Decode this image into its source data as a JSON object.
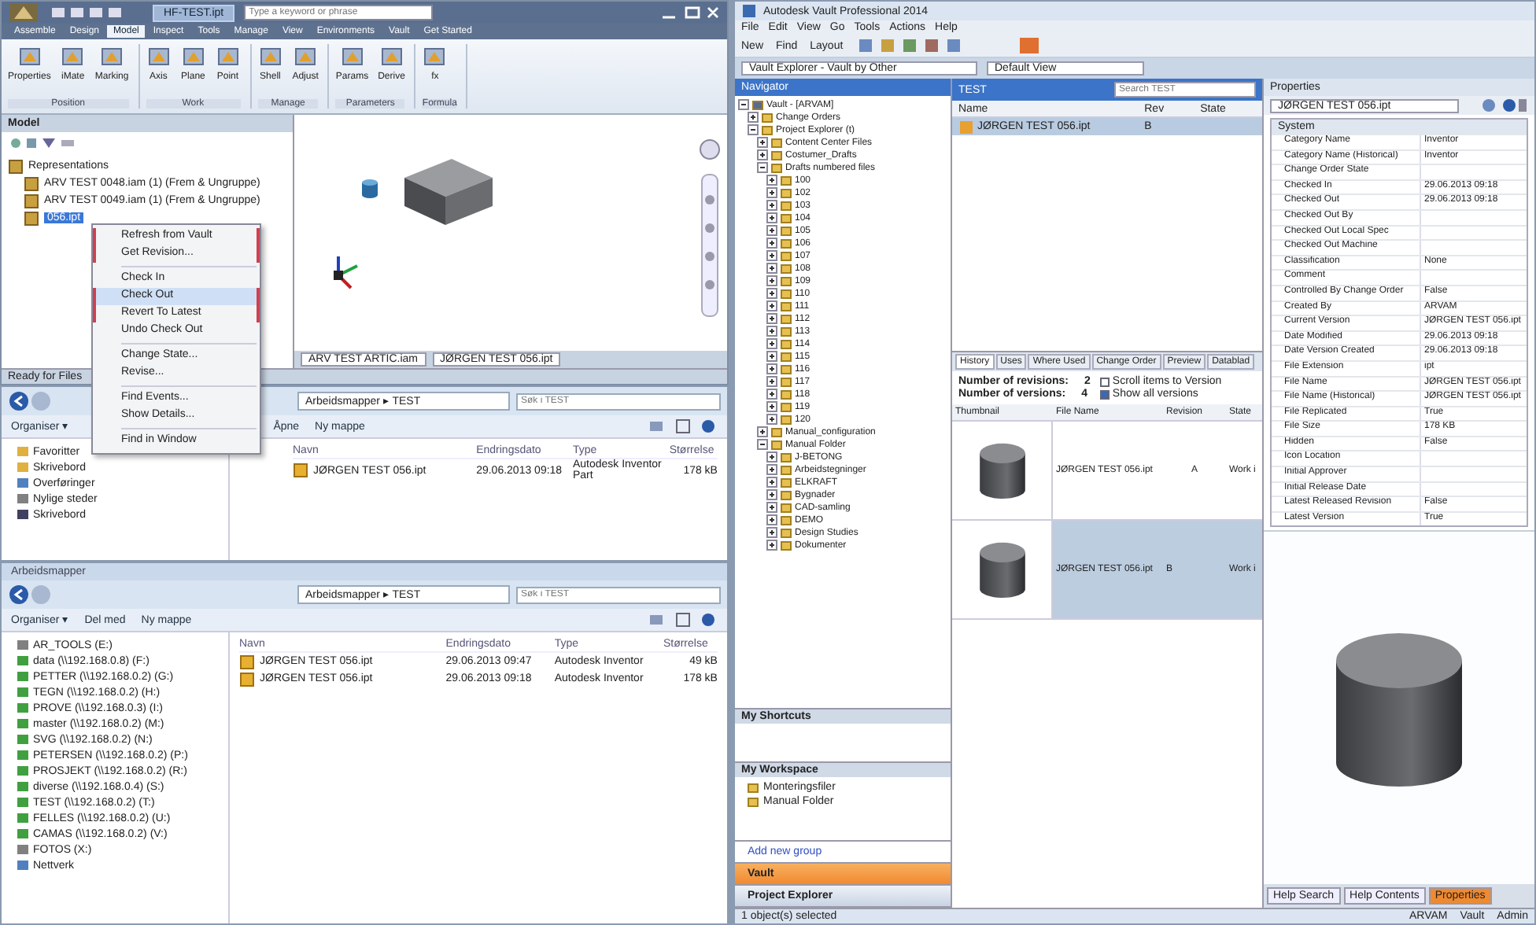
{
  "inventor": {
    "title_tab": "HF-TEST.ipt",
    "search": {
      "placeholder": "Type a keyword or phrase"
    },
    "ribbon_tabs": [
      {
        "label": "Assemble",
        "selected": false
      },
      {
        "label": "Design",
        "selected": false
      },
      {
        "label": "Model",
        "selected": true
      },
      {
        "label": "Inspect",
        "selected": false
      },
      {
        "label": "Tools",
        "selected": false
      },
      {
        "label": "Manage",
        "selected": false
      },
      {
        "label": "View",
        "selected": false
      },
      {
        "label": "Environments",
        "selected": false
      },
      {
        "label": "Vault",
        "selected": false
      },
      {
        "label": "Get Started",
        "selected": false
      }
    ],
    "ribbon_panels": [
      {
        "title": "Position",
        "tools": [
          "Properties",
          "iMate",
          "Marking"
        ]
      },
      {
        "title": "Work",
        "tools": [
          "Axis",
          "Plane",
          "Point"
        ]
      },
      {
        "title": "Manage",
        "tools": [
          "Shell",
          "Adjust"
        ]
      },
      {
        "title": "Parameters",
        "tools": [
          "Params",
          "Derive"
        ]
      },
      {
        "title": "Formula",
        "tools": [
          "fx"
        ]
      }
    ],
    "browser": {
      "title": "Model",
      "items": [
        {
          "label": "Representations",
          "selected": false
        },
        {
          "label": "ARV TEST 0048.iam (1) (Frem & Ungruppe)",
          "selected": false
        },
        {
          "label": "ARV TEST 0049.iam (1) (Frem & Ungruppe)",
          "selected": false
        },
        {
          "label": "056.ipt",
          "selected": true
        }
      ]
    },
    "viewport_tabs": [
      "ARV TEST ARTIC.iam",
      "JØRGEN TEST 056.ipt"
    ],
    "status": "Ready for Files"
  },
  "context_menu": [
    {
      "kind": "item",
      "label": "Refresh from Vault",
      "boxed": true,
      "hover": false
    },
    {
      "kind": "item",
      "label": "Get Revision...",
      "boxed": true,
      "hover": false
    },
    {
      "kind": "separator"
    },
    {
      "kind": "item",
      "label": "Check In",
      "boxed": false,
      "hover": false
    },
    {
      "kind": "item",
      "label": "Check Out",
      "boxed": true,
      "hover": true
    },
    {
      "kind": "item",
      "label": "Revert To Latest",
      "boxed": true,
      "hover": false
    },
    {
      "kind": "item",
      "label": "Undo Check Out",
      "boxed": false,
      "hover": false
    },
    {
      "kind": "separator"
    },
    {
      "kind": "item",
      "label": "Change State...",
      "boxed": false,
      "hover": false
    },
    {
      "kind": "item",
      "label": "Revise...",
      "boxed": false,
      "hover": false
    },
    {
      "kind": "separator"
    },
    {
      "kind": "item",
      "label": "Find Events...",
      "boxed": false,
      "hover": false
    },
    {
      "kind": "item",
      "label": "Show Details...",
      "boxed": false,
      "hover": false
    },
    {
      "kind": "separator"
    },
    {
      "kind": "item",
      "label": "Find in Window",
      "boxed": false,
      "hover": false
    }
  ],
  "explorers": [
    {
      "address": "Arbeidsmapper ▸ TEST",
      "search": {
        "placeholder": "Søk i TEST"
      },
      "toolbar": [
        "Organiser ▾",
        "Åpne",
        "Ny mappe"
      ],
      "nav": [
        {
          "label": "Favoritter",
          "color": "#e0b040"
        },
        {
          "label": "Skrivebord",
          "color": "#e0b040"
        },
        {
          "label": "Overføringer",
          "color": "#5080c0"
        },
        {
          "label": "Nylige steder",
          "color": "#808080"
        },
        {
          "label": "Skrivebord",
          "color": "#404060"
        }
      ],
      "columns": [
        "Navn",
        "Endringsdato",
        "Type",
        "Størrelse"
      ],
      "files": [
        {
          "name": "JØRGEN TEST 056.ipt",
          "date": "29.06.2013 09:18",
          "type": "Autodesk Inventor Part",
          "size": "178 kB"
        }
      ]
    },
    {
      "title": "Arbeidsmapper",
      "address": "Arbeidsmapper ▸ TEST",
      "search": {
        "placeholder": "Søk i TEST"
      },
      "toolbar": [
        "Organiser ▾",
        "Del med",
        "Ny mappe"
      ],
      "nav": [
        {
          "label": "AR_TOOLS (E:)",
          "color": "#808080"
        },
        {
          "label": "data (\\\\192.168.0.8) (F:)",
          "color": "#40a040"
        },
        {
          "label": "PETTER (\\\\192.168.0.2) (G:)",
          "color": "#40a040"
        },
        {
          "label": "TEGN (\\\\192.168.0.2) (H:)",
          "color": "#40a040"
        },
        {
          "label": "PROVE (\\\\192.168.0.3) (I:)",
          "color": "#40a040"
        },
        {
          "label": "master (\\\\192.168.0.2) (M:)",
          "color": "#40a040"
        },
        {
          "label": "SVG (\\\\192.168.0.2) (N:)",
          "color": "#40a040"
        },
        {
          "label": "PETERSEN (\\\\192.168.0.2) (P:)",
          "color": "#40a040"
        },
        {
          "label": "PROSJEKT (\\\\192.168.0.2) (R:)",
          "color": "#40a040"
        },
        {
          "label": "diverse (\\\\192.168.0.4) (S:)",
          "color": "#40a040"
        },
        {
          "label": "TEST (\\\\192.168.0.2) (T:)",
          "color": "#40a040"
        },
        {
          "label": "FELLES (\\\\192.168.0.2) (U:)",
          "color": "#40a040"
        },
        {
          "label": "CAMAS (\\\\192.168.0.2) (V:)",
          "color": "#40a040"
        },
        {
          "label": "FOTOS (X:)",
          "color": "#808080"
        },
        {
          "label": "Nettverk",
          "color": "#5080c0"
        }
      ],
      "columns": [
        "Navn",
        "Endringsdato",
        "Type",
        "Størrelse"
      ],
      "files": [
        {
          "name": "JØRGEN TEST 056.ipt",
          "date": "29.06.2013 09:47",
          "type": "Autodesk Inventor",
          "size": "49 kB"
        },
        {
          "name": "JØRGEN TEST 056.ipt",
          "date": "29.06.2013 09:18",
          "type": "Autodesk Inventor",
          "size": "178 kB"
        }
      ]
    }
  ],
  "vault": {
    "title": "Autodesk Vault Professional 2014",
    "menu": [
      "File",
      "Edit",
      "View",
      "Go",
      "Tools",
      "Actions",
      "Help"
    ],
    "toolbar": [
      "New",
      "Find",
      "Layout"
    ],
    "location": "Vault Explorer - Vault by Other",
    "view": "Default View",
    "navigator": {
      "title": "Navigator",
      "tree": [
        {
          "label": "Vault - [ARVAM]",
          "expanded": true,
          "children": [
            {
              "label": "Change Orders",
              "expanded": false
            },
            {
              "label": "Project Explorer (t)",
              "expanded": true,
              "children": [
                {
                  "label": "Content Center Files",
                  "expanded": false
                },
                {
                  "label": "Costumer_Drafts",
                  "expanded": false
                },
                {
                  "label": "Drafts numbered files",
                  "expanded": true,
                  "children": [
                    {
                      "label": "100",
                      "expanded": false
                    },
                    {
                      "label": "102",
                      "expanded": false
                    },
                    {
                      "label": "103",
                      "expanded": false
                    },
                    {
                      "label": "104",
                      "expanded": false
                    },
                    {
                      "label": "105",
                      "expanded": false
                    },
                    {
                      "label": "106",
                      "expanded": false
                    },
                    {
                      "label": "107",
                      "expanded": false
                    },
                    {
                      "label": "108",
                      "expanded": false
                    },
                    {
                      "label": "109",
                      "expanded": false
                    },
                    {
                      "label": "110",
                      "expanded": false
                    },
                    {
                      "label": "111",
                      "expanded": false
                    },
                    {
                      "label": "112",
                      "expanded": false
                    },
                    {
                      "label": "113",
                      "expanded": false
                    },
                    {
                      "label": "114",
                      "expanded": false
                    },
                    {
                      "label": "115",
                      "expanded": false
                    },
                    {
                      "label": "116",
                      "expanded": false
                    },
                    {
                      "label": "117",
                      "expanded": false
                    },
                    {
                      "label": "118",
                      "expanded": false
                    },
                    {
                      "label": "119",
                      "expanded": false
                    },
                    {
                      "label": "120",
                      "expanded": false
                    }
                  ]
                },
                {
                  "label": "Manual_configuration",
                  "expanded": false
                },
                {
                  "label": "Manual Folder",
                  "expanded": true,
                  "children": [
                    {
                      "label": "J-BETONG",
                      "expanded": false
                    },
                    {
                      "label": "Arbeidstegninger",
                      "expanded": false
                    },
                    {
                      "label": "ELKRAFT",
                      "expanded": false
                    },
                    {
                      "label": "Bygnader",
                      "expanded": false
                    },
                    {
                      "label": "CAD-samling",
                      "expanded": false
                    },
                    {
                      "label": "DEMO",
                      "expanded": false
                    },
                    {
                      "label": "Design Studies",
                      "expanded": false
                    },
                    {
                      "label": "Dokumenter",
                      "expanded": false
                    }
                  ]
                }
              ]
            }
          ]
        }
      ]
    },
    "shortcuts": {
      "title": "My Shortcuts"
    },
    "groups": {
      "title": "My Workspace",
      "items": [
        "Monteringsfiler",
        "Manual Folder"
      ],
      "link": "Add new group"
    },
    "nav_buttons": [
      {
        "label": "Vault",
        "selected": true
      },
      {
        "label": "Project Explorer",
        "selected": false
      }
    ],
    "folder": {
      "title": "TEST",
      "search": {
        "placeholder": "Search TEST"
      },
      "columns": [
        "Name",
        "Rev",
        "State"
      ],
      "rows": [
        {
          "name": "JØRGEN TEST 056.ipt",
          "rev": "B",
          "selected": true
        }
      ]
    },
    "detail_tabs": [
      {
        "label": "History",
        "selected": true
      },
      {
        "label": "Uses",
        "selected": false
      },
      {
        "label": "Where Used",
        "selected": false
      },
      {
        "label": "Change Order",
        "selected": false
      },
      {
        "label": "Preview",
        "selected": false
      },
      {
        "label": "Datablad",
        "selected": false
      }
    ],
    "history": {
      "stats": [
        {
          "label": "Number of revisions:",
          "value": "2"
        },
        {
          "label": "Number of versions:",
          "value": "4"
        }
      ],
      "options": [
        {
          "label": "Scroll items to Version",
          "checked": false
        },
        {
          "label": "Show all versions",
          "checked": true
        }
      ],
      "columns": [
        "Thumbnail",
        "File Name",
        "Revision",
        "State"
      ],
      "rows": [
        {
          "file": "JØRGEN TEST 056.ipt",
          "revision": "A",
          "state": "Work i",
          "selected": false
        },
        {
          "file": "JØRGEN TEST 056.ipt",
          "revision": "B",
          "state": "Work i",
          "selected": true
        }
      ]
    },
    "properties": {
      "title": "Properties",
      "file": "JØRGEN TEST 056.ipt",
      "group": "System",
      "rows": [
        {
          "name": "Category Name",
          "value": "Inventor"
        },
        {
          "name": "Category Name (Historical)",
          "value": "Inventor"
        },
        {
          "name": "Change Order State",
          "value": ""
        },
        {
          "name": "Checked In",
          "value": "29.06.2013 09:18"
        },
        {
          "name": "Checked Out",
          "value": "29.06.2013 09:18"
        },
        {
          "name": "Checked Out By",
          "value": ""
        },
        {
          "name": "Checked Out Local Spec",
          "value": ""
        },
        {
          "name": "Checked Out Machine",
          "value": ""
        },
        {
          "name": "Classification",
          "value": "None"
        },
        {
          "name": "Comment",
          "value": ""
        },
        {
          "name": "Controlled By Change Order",
          "value": "False"
        },
        {
          "name": "Created By",
          "value": "ARVAM"
        },
        {
          "name": "Current Version",
          "value": "JØRGEN TEST 056.ipt"
        },
        {
          "name": "Date Modified",
          "value": "29.06.2013 09:18"
        },
        {
          "name": "Date Version Created",
          "value": "29.06.2013 09:18"
        },
        {
          "name": "File Extension",
          "value": "ipt"
        },
        {
          "name": "File Name",
          "value": "JØRGEN TEST 056.ipt"
        },
        {
          "name": "File Name (Historical)",
          "value": "JØRGEN TEST 056.ipt"
        },
        {
          "name": "File Replicated",
          "value": "True"
        },
        {
          "name": "File Size",
          "value": "178 KB"
        },
        {
          "name": "Hidden",
          "value": "False"
        },
        {
          "name": "Icon Location",
          "value": ""
        },
        {
          "name": "Initial Approver",
          "value": ""
        },
        {
          "name": "Initial Release Date",
          "value": ""
        },
        {
          "name": "Latest Released Revision",
          "value": "False"
        },
        {
          "name": "Latest Version",
          "value": "True"
        }
      ]
    },
    "side_tabs": [
      {
        "label": "Help Search",
        "selected": false
      },
      {
        "label": "Help Contents",
        "selected": false
      },
      {
        "label": "Properties",
        "selected": true
      }
    ],
    "status": "1 object(s) selected",
    "status_right": [
      "ARVAM",
      "Vault",
      "Admin"
    ]
  }
}
